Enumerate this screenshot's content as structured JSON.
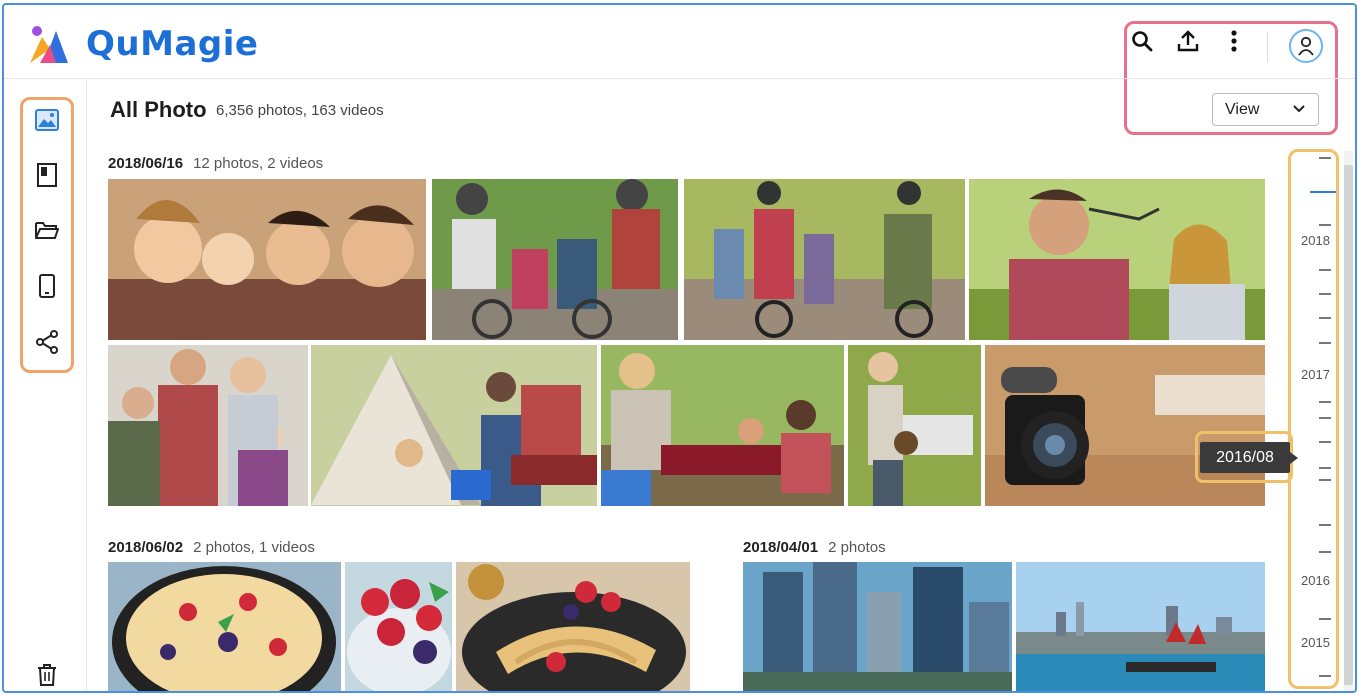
{
  "app": {
    "name": "QuMagie"
  },
  "header": {
    "icons": [
      "search-icon",
      "upload-icon",
      "more-icon",
      "user-icon"
    ]
  },
  "page": {
    "title": "All Photo",
    "summary": "6,356 photos, 163 videos",
    "view_label": "View"
  },
  "groups": [
    {
      "date": "2018/06/16",
      "count": "12 photos, 2 videos"
    },
    {
      "date": "2018/06/02",
      "count": "2 photos, 1 videos"
    },
    {
      "date": "2018/04/01",
      "count": "2 photos"
    }
  ],
  "timeline": {
    "years": [
      "2018",
      "2017",
      "2016",
      "2015"
    ],
    "tooltip": "2016/08"
  },
  "colors": {
    "brand": "#1d6fd8",
    "accent": "#2d7fe0",
    "sidebar_highlight": "#f0a36a",
    "topbar_highlight": "#e8718a",
    "timeline_highlight": "#f0c06a"
  }
}
